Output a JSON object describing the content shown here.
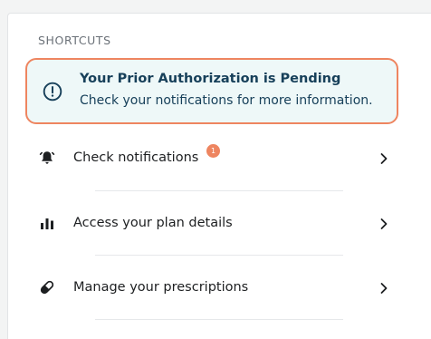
{
  "shortcuts": {
    "heading": "SHORTCUTS",
    "alert": {
      "title": "Your Prior Authorization is Pending",
      "message": "Check your notifications for more information.",
      "icon": "exclamation-circle-icon",
      "border_color": "#ee8560",
      "background_color": "#eef8f8",
      "text_color": "#17405a"
    },
    "items": [
      {
        "label": "Check notifications",
        "icon": "bell-icon",
        "badge": "1"
      },
      {
        "label": "Access your plan details",
        "icon": "bar-chart-icon"
      },
      {
        "label": "Manage your prescriptions",
        "icon": "pill-icon"
      }
    ]
  }
}
